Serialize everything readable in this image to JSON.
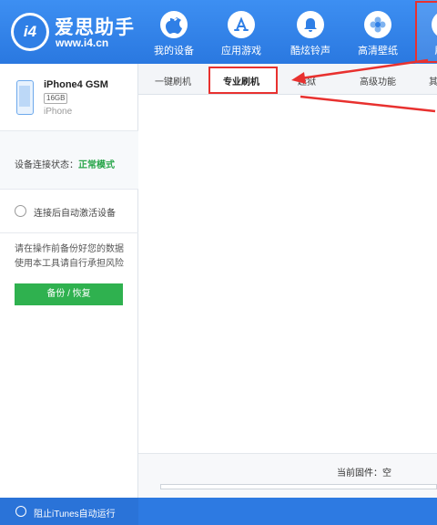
{
  "brand": {
    "logo_text": "i4",
    "name_cn": "爱思助手",
    "url": "www.i4.cn"
  },
  "nav": {
    "items": [
      {
        "label": "我的设备",
        "icon": "apple-icon"
      },
      {
        "label": "应用游戏",
        "icon": "app-store-icon"
      },
      {
        "label": "酷炫铃声",
        "icon": "bell-icon"
      },
      {
        "label": "高清壁纸",
        "icon": "flower-icon"
      },
      {
        "label": "刷",
        "icon": "flash-icon"
      }
    ]
  },
  "device": {
    "name": "iPhone4 GSM",
    "capacity": "16GB",
    "type": "iPhone"
  },
  "status": {
    "label": "设备连接状态：",
    "value": "正常模式"
  },
  "auto_activate_label": "连接后自动激活设备",
  "notice": "请在操作前备份好您的数据使用本工具请自行承担风险",
  "backup_button": "备份 / 恢复",
  "tabs": [
    "一键刷机",
    "专业刷机",
    "越狱",
    "高级功能",
    "其"
  ],
  "firmware_label": "当前固件：空",
  "itunes_label": "阻止iTunes自动运行",
  "colors": {
    "primary_blue": "#2f7fe6",
    "highlight_red": "#e8312f",
    "status_green": "#2aa64b",
    "button_green": "#2fb14f"
  }
}
